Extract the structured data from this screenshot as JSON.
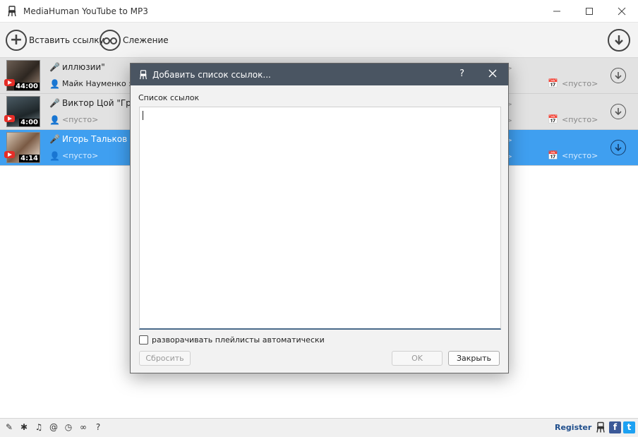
{
  "window": {
    "title": "MediaHuman YouTube to MP3"
  },
  "toolbar": {
    "paste_label": "Вставить ссылку",
    "track_label": "Слежение"
  },
  "rows": [
    {
      "title": "иллюзии\"",
      "artist": "Майк Науменко : \"...",
      "duration": "44:00",
      "right_frag1": "о>",
      "date": "<пусто>"
    },
    {
      "title": "Виктор Цой \"Групп",
      "artist": "<пусто>",
      "duration": "4:00",
      "right_frag1": "о>",
      "right_frag2": "о>",
      "date": "<пусто>"
    },
    {
      "title": "Игорь Тальков \"Ле",
      "artist": "<пусто>",
      "duration": "4:14",
      "right_frag1": "о>",
      "right_frag2": "о>",
      "date": "<пусто>"
    }
  ],
  "dialog": {
    "title": "Добавить список ссылок...",
    "help": "?",
    "list_label": "Список ссылок",
    "textarea_value": "",
    "expand_playlists_label": "разворачивать плейлисты автоматически",
    "reset_label": "Сбросить",
    "ok_label": "OK",
    "close_label": "Закрыть"
  },
  "statusbar": {
    "register_label": "Register",
    "facebook": "f",
    "twitter": "t"
  },
  "colors": {
    "selected_row": "#3f9ff0",
    "dialog_title": "#4a5562",
    "register": "#1f4e8c",
    "facebook": "#3b5998",
    "twitter": "#1da1f2",
    "youtube": "#e52d27"
  }
}
